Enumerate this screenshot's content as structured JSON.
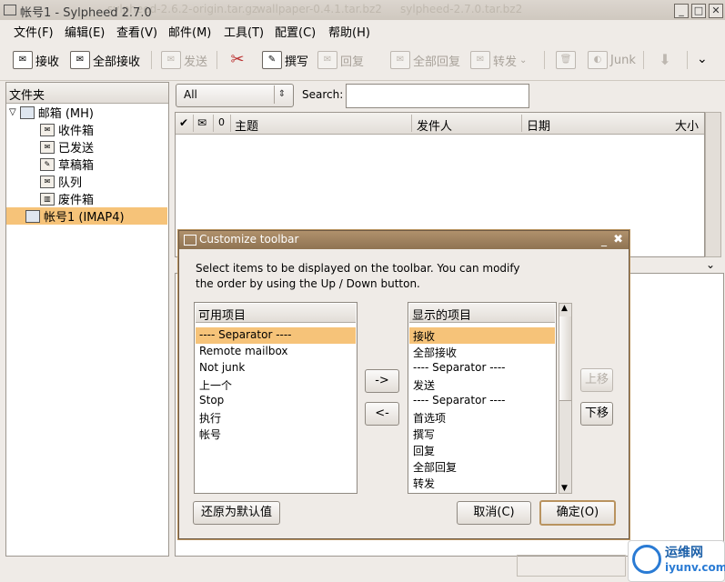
{
  "window": {
    "title": "帐号1 - Sylpheed 2.7.0",
    "bg_tabs": [
      "sylpheed-2.7.0.tar.bz2",
      "wallpaper-0.4.1.tar.bz2",
      "sylpheed-2.6.2-origin.tar.gz"
    ],
    "minimize_label": "_",
    "maximize_label": "□",
    "close_label": "✕"
  },
  "menubar": [
    "文件(F)",
    "编辑(E)",
    "查看(V)",
    "邮件(M)",
    "工具(T)",
    "配置(C)",
    "帮助(H)"
  ],
  "toolbar": {
    "items": [
      {
        "label": "接收",
        "icon": "mail-receive-icon",
        "enabled": true
      },
      {
        "label": "全部接收",
        "icon": "mail-receive-all-icon",
        "enabled": true
      },
      {
        "label": "发送",
        "icon": "mail-send-icon",
        "enabled": false
      },
      {
        "label": "",
        "icon": "preferences-icon",
        "enabled": true
      },
      {
        "label": "撰写",
        "icon": "compose-icon",
        "enabled": true
      },
      {
        "label": "回复",
        "icon": "reply-icon",
        "enabled": false
      },
      {
        "label": "全部回复",
        "icon": "reply-all-icon",
        "enabled": false
      },
      {
        "label": "转发",
        "icon": "forward-icon",
        "enabled": false
      },
      {
        "label": "",
        "icon": "trash-icon",
        "enabled": false
      },
      {
        "label": "Junk",
        "icon": "junk-icon",
        "enabled": false
      },
      {
        "label": "",
        "icon": "next-arrow-icon",
        "enabled": false
      }
    ],
    "overflow_label": "⌄"
  },
  "folder_pane": {
    "header": "文件夹",
    "tree": [
      {
        "label": "邮箱 (MH)",
        "icon": "mailbox-folder-icon",
        "expander": "▽",
        "selected": false
      },
      {
        "label": "收件箱",
        "icon": "inbox-icon",
        "selected": false
      },
      {
        "label": "已发送",
        "icon": "outbox-icon",
        "selected": false
      },
      {
        "label": "草稿箱",
        "icon": "draft-icon",
        "selected": false
      },
      {
        "label": "队列",
        "icon": "queue-icon",
        "selected": false
      },
      {
        "label": "废件箱",
        "icon": "trash-icon",
        "selected": false
      },
      {
        "label": "帐号1 (IMAP4)",
        "icon": "imap-folder-icon",
        "selected": true
      }
    ],
    "selected_color": "#f6c379"
  },
  "filter": {
    "value": "All",
    "arrow": "⇕"
  },
  "search": {
    "label": "Search:",
    "value": ""
  },
  "message_list": {
    "columns": [
      "✔",
      "✉",
      "0",
      "主题",
      "发件人",
      "日期",
      "大小"
    ],
    "rows": []
  },
  "dialog": {
    "title": "Customize toolbar",
    "minimize_label": "_",
    "close_label": "✖",
    "desc_line1": "Select items to be displayed on the toolbar. You can modify",
    "desc_line2": "the order by using the Up / Down button.",
    "available": {
      "header": "可用项目",
      "items": [
        "---- Separator ----",
        "Remote mailbox",
        "Not junk",
        "上一个",
        "Stop",
        "执行",
        "帐号"
      ],
      "selected_index": 0
    },
    "displayed": {
      "header": "显示的项目",
      "items": [
        "接收",
        "全部接收",
        "---- Separator ----",
        "发送",
        "---- Separator ----",
        "首选项",
        "撰写",
        "回复",
        "全部回复",
        "转发"
      ],
      "selected_index": 0
    },
    "add_button": "->",
    "remove_button": "<-",
    "up_button": "上移",
    "up_enabled": false,
    "down_button": "下移",
    "reset_button": "还原为默认值",
    "cancel_button": "取消(C)",
    "ok_button": "确定(O)",
    "accent_color": "#b9935f"
  },
  "watermark": {
    "line1": "运维网",
    "line2": "iyunv.com"
  }
}
